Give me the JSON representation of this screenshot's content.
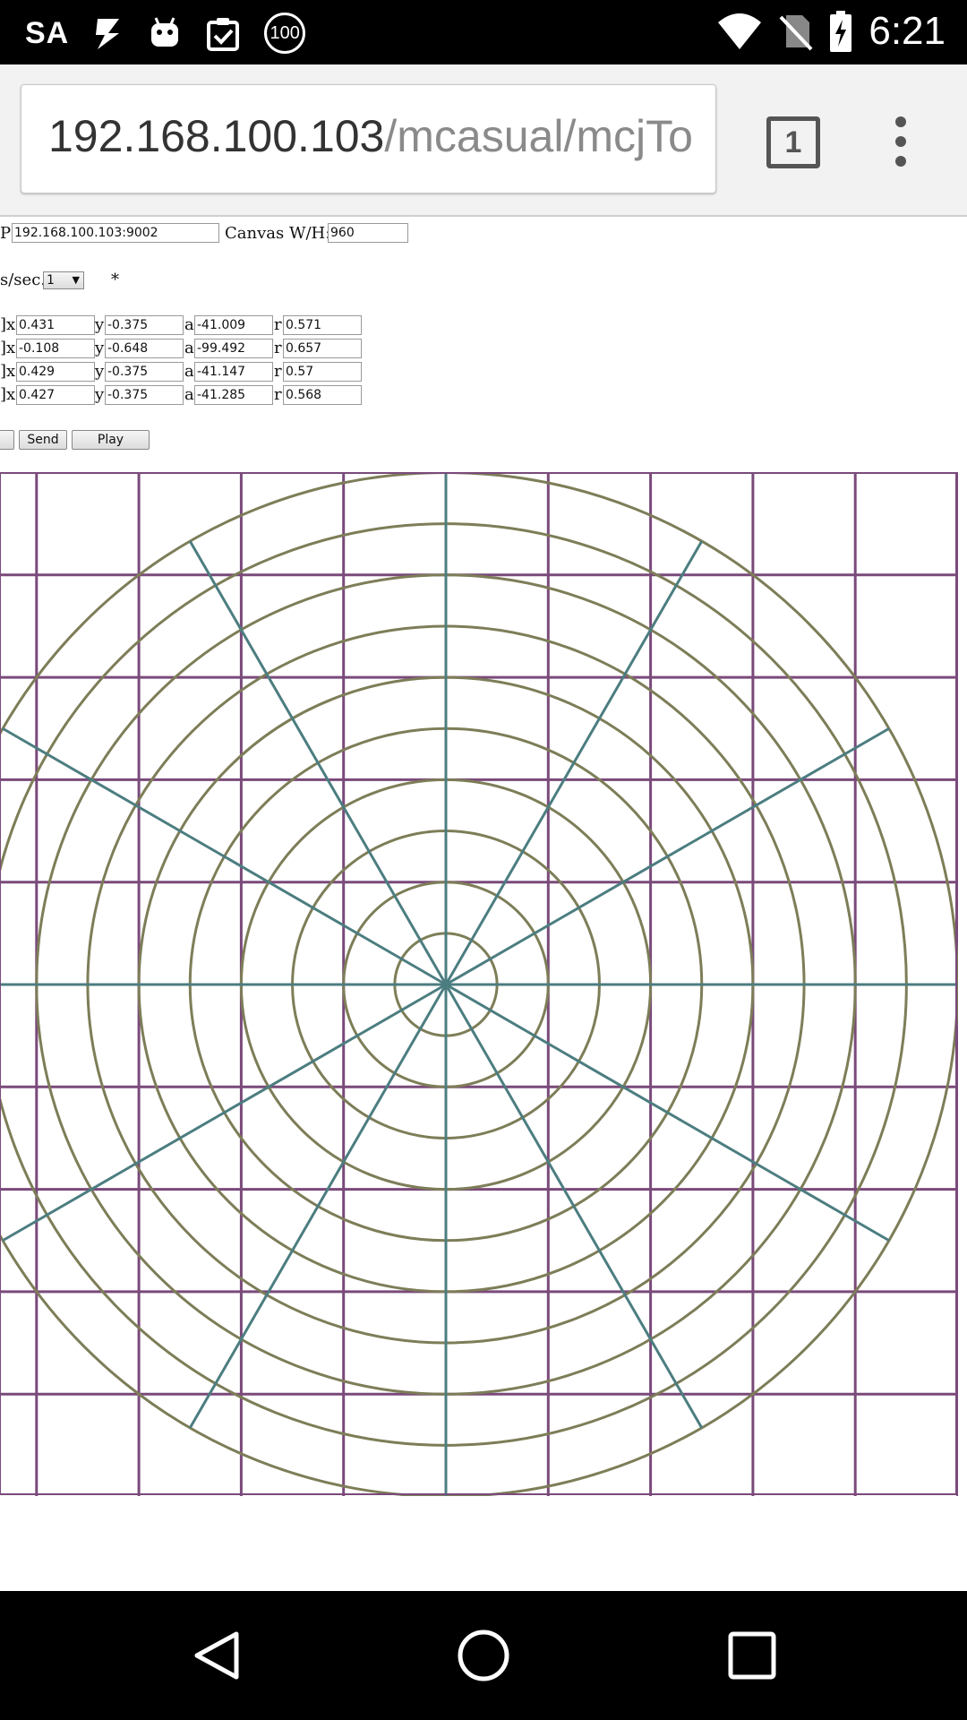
{
  "status_bar": {
    "carrier": "SA",
    "time": "6:21",
    "badge": "100",
    "icons": [
      "deal-icon",
      "android-icon",
      "clipboard-check-icon",
      "badge-100-icon",
      "wifi-icon",
      "no-sim-icon",
      "battery-charging-icon"
    ]
  },
  "browser": {
    "url_host": "192.168.100.103",
    "url_path": "/mcasual/mcjTo",
    "tab_count": "1"
  },
  "form": {
    "ip_label": "P:",
    "ip_value": "192.168.100.103:9002",
    "canvas_label": "Canvas W/H:",
    "canvas_value": "960",
    "rate_label": "s/sec.",
    "rate_value": "1",
    "asterisk": "*",
    "rows": [
      {
        "prefix": "]x",
        "x": "0.431",
        "y": "-0.375",
        "a": "-41.009",
        "r": "0.571"
      },
      {
        "prefix": "]x",
        "x": "-0.108",
        "y": "-0.648",
        "a": "-99.492",
        "r": "0.657"
      },
      {
        "prefix": "]x",
        "x": "0.429",
        "y": "-0.375",
        "a": "-41.147",
        "r": "0.57"
      },
      {
        "prefix": "]x",
        "x": "0.427",
        "y": "-0.375",
        "a": "-41.285",
        "r": "0.568"
      }
    ],
    "y_label": "y",
    "a_label": "a",
    "r_label": "r",
    "send_label": "Send",
    "play_label": "Play"
  },
  "canvas": {
    "colors": {
      "grid": "#7a4a7a",
      "circles": "#7d7d58",
      "spokes": "#4c7d80",
      "border": "#7a4a7a"
    },
    "grid_lines": 10,
    "circle_count": 10,
    "spoke_count": 12
  }
}
